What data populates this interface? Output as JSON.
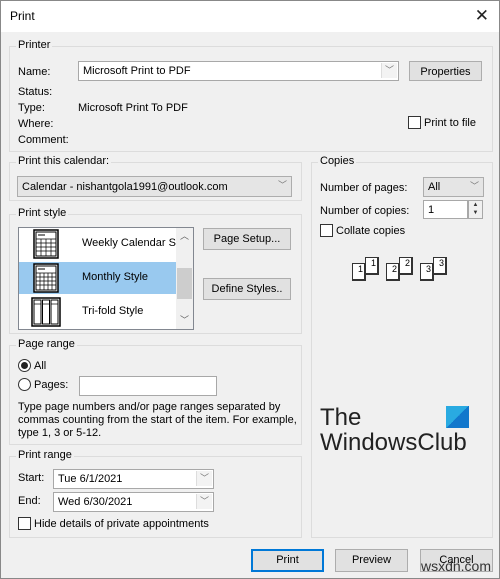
{
  "window": {
    "title": "Print"
  },
  "printer": {
    "legend": "Printer",
    "name_label": "Name:",
    "name_value": "Microsoft Print to PDF",
    "properties_button": "Properties",
    "status_label": "Status:",
    "status_value": "",
    "type_label": "Type:",
    "type_value": "Microsoft Print To PDF",
    "where_label": "Where:",
    "comment_label": "Comment:",
    "print_to_file_label": "Print to file",
    "print_to_file_checked": false
  },
  "calendar": {
    "legend": "Print this calendar:",
    "selected": "Calendar - nishantgola1991@outlook.com"
  },
  "print_style": {
    "legend": "Print style",
    "items": [
      {
        "label": "Weekly Calendar Style",
        "icon": "weekly-calendar-icon",
        "selected": false
      },
      {
        "label": "Monthly Style",
        "icon": "monthly-calendar-icon",
        "selected": true
      },
      {
        "label": "Tri-fold Style",
        "icon": "trifold-icon",
        "selected": false
      }
    ],
    "page_setup_button": "Page Setup...",
    "define_styles_button": "Define Styles.."
  },
  "copies": {
    "legend": "Copies",
    "pages_label": "Number of pages:",
    "pages_value": "All",
    "copies_label": "Number of copies:",
    "copies_value": "1",
    "collate_label": "Collate copies",
    "collate_checked": false,
    "collate_pages": [
      "1",
      "1",
      "2",
      "2",
      "3",
      "3"
    ]
  },
  "page_range": {
    "legend": "Page range",
    "all_label": "All",
    "pages_label": "Pages:",
    "pages_value": "",
    "selected": "All",
    "help_text": "Type page numbers and/or page ranges separated by commas counting from the start of the item.  For example, type 1, 3 or 5-12."
  },
  "print_range": {
    "legend": "Print range",
    "start_label": "Start:",
    "start_value": "Tue 6/1/2021",
    "end_label": "End:",
    "end_value": "Wed 6/30/2021",
    "hide_private_label": "Hide details of private appointments",
    "hide_private_checked": false
  },
  "logo": {
    "line1": "The",
    "line2": "WindowsClub"
  },
  "footer": {
    "print": "Print",
    "preview": "Preview",
    "cancel": "Cancel"
  },
  "watermark": "wsxdn.com"
}
